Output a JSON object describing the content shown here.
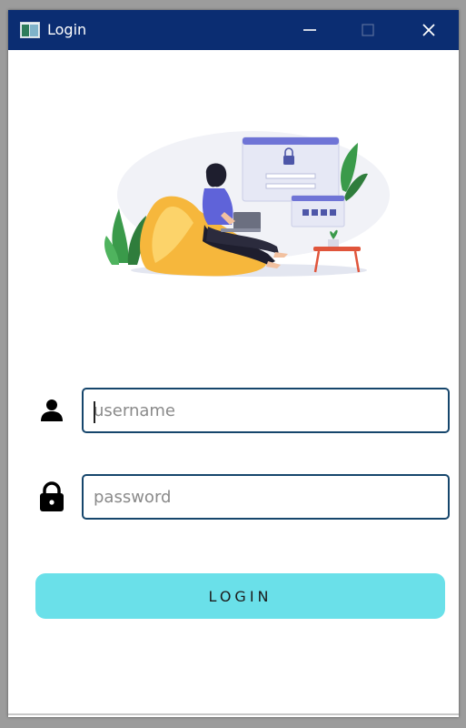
{
  "window": {
    "title": "Login",
    "icon": "app-window-icon",
    "controls": [
      "minimize-icon",
      "maximize-icon",
      "close-icon"
    ]
  },
  "illustration": {
    "description_icon": "login-illustration"
  },
  "form": {
    "username": {
      "placeholder": "username",
      "value": "",
      "icon": "user-icon"
    },
    "password": {
      "placeholder": "password",
      "value": "",
      "icon": "lock-icon"
    },
    "login_label": "LOGIN"
  },
  "colors": {
    "titlebar": "#0b2d72",
    "input_border": "#16466c",
    "login_button": "#6ae0e9"
  }
}
